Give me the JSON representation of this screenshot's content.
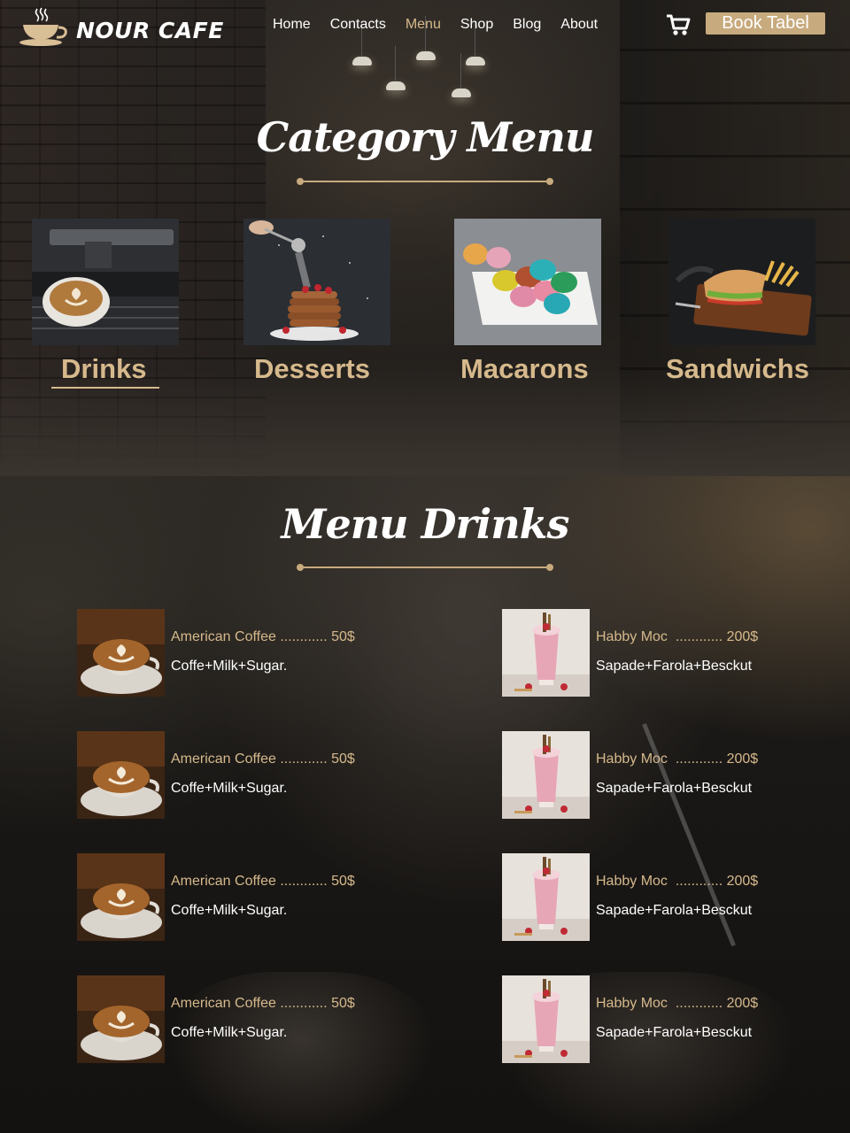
{
  "brand": {
    "name": "NOUR CAFE"
  },
  "nav": {
    "links": [
      "Home",
      "Contacts",
      "Menu",
      "Shop",
      "Blog",
      "About"
    ],
    "active": "Menu",
    "cart_icon": "cart-icon",
    "book_label": "Book Tabel"
  },
  "category_section": {
    "title": "Category Menu",
    "categories": [
      {
        "label": "Drinks",
        "image": "espresso-machine-latte"
      },
      {
        "label": "Desserts",
        "image": "pancake-stack-sugar"
      },
      {
        "label": "Macarons",
        "image": "macarons-plate"
      },
      {
        "label": "Sandwichs",
        "image": "sandwich-fries-board"
      }
    ],
    "selected": "Drinks"
  },
  "menu_section": {
    "title": "Menu Drinks",
    "left_items": [
      {
        "name": "American Coffee ............ 50$",
        "desc": "Coffe+Milk+Sugar."
      },
      {
        "name": "American Coffee ............ 50$",
        "desc": "Coffe+Milk+Sugar."
      },
      {
        "name": "American Coffee ............ 50$",
        "desc": "Coffe+Milk+Sugar."
      },
      {
        "name": "American Coffee ............ 50$",
        "desc": "Coffe+Milk+Sugar."
      }
    ],
    "right_items": [
      {
        "name": "Habby Moc  ............ 200$",
        "desc": "Sapade+Farola+Besckut"
      },
      {
        "name": "Habby Moc  ............ 200$",
        "desc": "Sapade+Farola+Besckut"
      },
      {
        "name": "Habby Moc  ............ 200$",
        "desc": "Sapade+Farola+Besckut"
      },
      {
        "name": "Habby Moc  ............ 200$",
        "desc": "Sapade+Farola+Besckut"
      }
    ]
  },
  "colors": {
    "accent": "#c7aa7d",
    "accent_text": "#d6b98c",
    "background": "#141210"
  }
}
